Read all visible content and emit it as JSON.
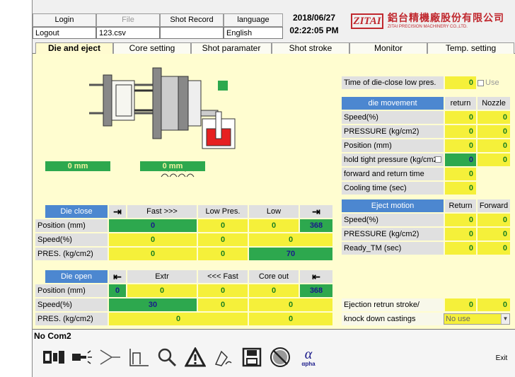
{
  "topbar": {
    "login": "Login",
    "file": "File",
    "shot_record": "Shot Record",
    "language_label": "language",
    "date": "2018/06/27",
    "logout": "Logout",
    "file_name": "123.csv",
    "language_value": "English",
    "time": "02:22:05 PM",
    "logo_mark": "ZITAI",
    "logo_cn": "鋁台精機廠股份有限公司",
    "logo_en": "ZITAI PRECISION MACHINERY CO.,LTD."
  },
  "tabs": [
    "Die and eject",
    "Core setting",
    "Shot paramater",
    "Shot stroke",
    "Monitor",
    "Temp. setting"
  ],
  "diagram": {
    "left_position": "0 mm",
    "right_position": "0 mm"
  },
  "die_close_low_pres": {
    "label": "Time of die-close low pres.",
    "value": "0",
    "use_label": "Use"
  },
  "die_movement": {
    "header": "die movement",
    "col_return": "return",
    "col_nozzle": "Nozzle",
    "rows": [
      {
        "label": "Speed(%)",
        "return": "0",
        "nozzle": "0"
      },
      {
        "label": "PRESSURE (kg/cm2)",
        "return": "0",
        "nozzle": "0"
      },
      {
        "label": "Position (mm)",
        "return": "0",
        "nozzle": "0"
      },
      {
        "label": "hold tight pressure (kg/cm2",
        "return": "0",
        "nozzle": "0"
      },
      {
        "label": "forward and return time",
        "return": "0",
        "nozzle": ""
      },
      {
        "label": "Cooling time (sec)",
        "return": "0",
        "nozzle": ""
      }
    ]
  },
  "die_close": {
    "header": "Die close",
    "col_fast": "Fast >>>",
    "col_lowpres": "Low Pres.",
    "col_low": "Low",
    "position_label": "Position (mm)",
    "position": [
      "0",
      "0",
      "0",
      "368"
    ],
    "speed_label": "Speed(%)",
    "speed": [
      "0",
      "0",
      "0"
    ],
    "pres_label": "PRES. (kg/cm2)",
    "pres": [
      "0",
      "0",
      "70"
    ]
  },
  "die_open": {
    "header": "Die open",
    "col_extr": "Extr",
    "col_fast": "<<< Fast",
    "col_core": "Core out",
    "position_label": "Position (mm)",
    "position": [
      "0",
      "0",
      "0",
      "0",
      "368"
    ],
    "speed_label": "Speed(%)",
    "speed": [
      "30",
      "0",
      "0"
    ],
    "pres_label": "PRES. (kg/cm2)",
    "pres": [
      "0",
      "0"
    ]
  },
  "eject": {
    "header": "Eject motion",
    "col_return": "Return",
    "col_forward": "Forward",
    "rows": [
      {
        "label": "Speed(%)",
        "return": "0",
        "forward": "0"
      },
      {
        "label": "PRESSURE (kg/cm2)",
        "return": "0",
        "forward": "0"
      },
      {
        "label": "Ready_TM (sec)",
        "return": "0",
        "forward": "0"
      }
    ],
    "retrun_stroke_label": "Ejection retrun stroke/",
    "retrun_stroke_a": "0",
    "retrun_stroke_b": "0",
    "knock_label": "knock down castings",
    "knock_value": "No use"
  },
  "status": "No Com2",
  "toolbar": {
    "exit": "Exit",
    "icons": [
      "machine-icon",
      "injector-icon",
      "funnel-icon",
      "curve-icon",
      "search-icon",
      "warning-icon",
      "pen-icon",
      "disk-icon",
      "no-fan-icon",
      "alpha-icon"
    ],
    "alpha_text": "αpha"
  }
}
